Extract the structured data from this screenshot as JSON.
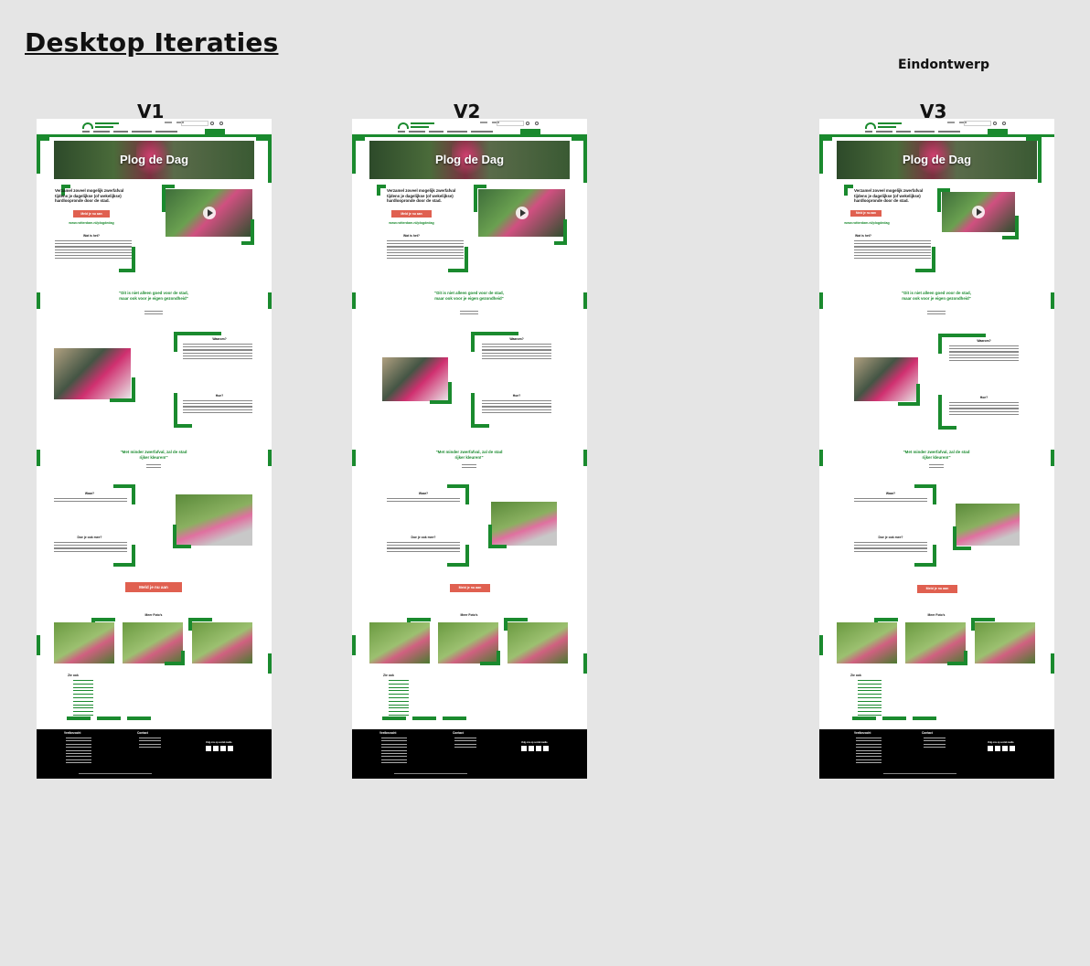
{
  "board": {
    "title": "Desktop Iteraties",
    "note": "Eindontwerp"
  },
  "variants": [
    {
      "label": "V1"
    },
    {
      "label": "V2"
    },
    {
      "label": "V3"
    }
  ],
  "page": {
    "hero_title": "Plog de Dag",
    "intro_heading": "Verzamel zoveel mogelijk zwerfafval tijdens je dagelijkse (of wekelijkse) hardloopronde door de stad.",
    "signup_button": "Meld je nu aan",
    "url": "www.rotterdam.nl/plogdedag",
    "what_heading": "Wat is het?",
    "quote_1": "\"Dit is niet alleen goed voor de stad, maar ook voor je eigen gezondheid\"",
    "why_heading": "Waarom?",
    "how_heading": "Hoe?",
    "quote_2": "\"Met minder zwerfafval, zal de stad rijker kleuren!\"",
    "where_heading": "Waar?",
    "join_heading": "Doe je ook mee?",
    "signup_button_large": "Meld je nu aan",
    "photos_heading": "Meer Foto's",
    "see_also": "Zie ook",
    "footer_col1": "Veelbezocht",
    "footer_col2": "Contact",
    "footer_col3": "Volg ons op social media"
  },
  "colors": {
    "brand_green": "#1a8a2e",
    "cta_red": "#e06050",
    "footer_black": "#000000",
    "canvas": "#e5e5e5"
  }
}
